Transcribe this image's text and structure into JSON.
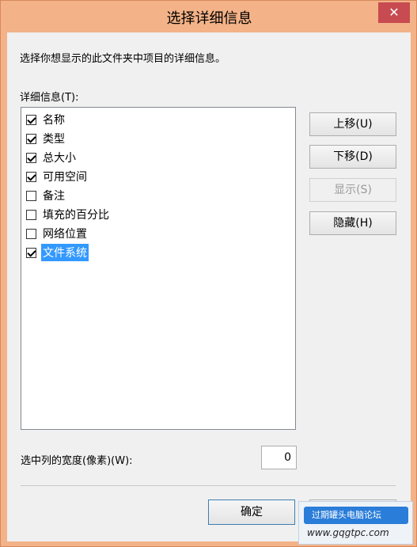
{
  "window": {
    "title": "选择详细信息",
    "close": "✕"
  },
  "dialog": {
    "description": "选择你想显示的此文件夹中项目的详细信息。",
    "list_label": "详细信息(T):",
    "items": [
      {
        "label": "名称",
        "checked": true
      },
      {
        "label": "类型",
        "checked": true
      },
      {
        "label": "总大小",
        "checked": true
      },
      {
        "label": "可用空间",
        "checked": true
      },
      {
        "label": "备注",
        "checked": false
      },
      {
        "label": "填充的百分比",
        "checked": false
      },
      {
        "label": "网络位置",
        "checked": false
      },
      {
        "label": "文件系统",
        "checked": true,
        "selected": true
      }
    ],
    "buttons": {
      "move_up": "上移(U)",
      "move_down": "下移(D)",
      "show": "显示(S)",
      "hide": "隐藏(H)",
      "ok": "确定"
    },
    "width_label": "选中列的宽度(像素)(W):",
    "width_value": "0"
  },
  "watermark": {
    "badge": "过期罐头电脑论坛",
    "url": "www.gqgtpc.com"
  }
}
